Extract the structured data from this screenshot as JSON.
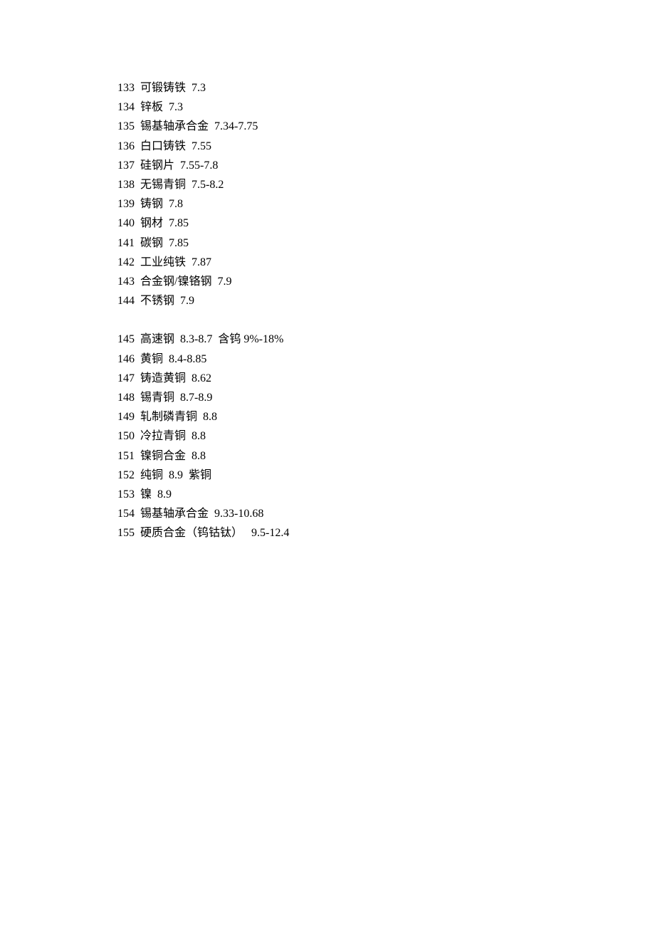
{
  "block1": [
    {
      "num": "133",
      "name": "可锻铸铁",
      "value": "7.3",
      "extra": ""
    },
    {
      "num": "134",
      "name": "锌板",
      "value": "7.3",
      "extra": ""
    },
    {
      "num": "135",
      "name": "锡基轴承合金",
      "value": "7.34-7.75",
      "extra": ""
    },
    {
      "num": "136",
      "name": "白口铸铁",
      "value": "7.55",
      "extra": ""
    },
    {
      "num": "137",
      "name": "硅钢片",
      "value": "7.55-7.8",
      "extra": ""
    },
    {
      "num": "138",
      "name": "无锡青铜",
      "value": "7.5-8.2",
      "extra": ""
    },
    {
      "num": "139",
      "name": "铸钢",
      "value": "7.8",
      "extra": ""
    },
    {
      "num": "140",
      "name": "钢材",
      "value": "7.85",
      "extra": ""
    },
    {
      "num": "141",
      "name": "碳钢",
      "value": "7.85",
      "extra": ""
    },
    {
      "num": "142",
      "name": "工业纯铁",
      "value": "7.87",
      "extra": ""
    },
    {
      "num": "143",
      "name": "合金钢/镍铬钢",
      "value": "7.9",
      "extra": ""
    },
    {
      "num": "144",
      "name": "不锈钢",
      "value": "7.9",
      "extra": ""
    }
  ],
  "block2": [
    {
      "num": "145",
      "name": "高速钢",
      "value": "8.3-8.7",
      "extra": "含钨 9%-18%"
    },
    {
      "num": "146",
      "name": "黄铜",
      "value": "8.4-8.85",
      "extra": ""
    },
    {
      "num": "147",
      "name": "铸造黄铜",
      "value": "8.62",
      "extra": ""
    },
    {
      "num": "148",
      "name": "锡青铜",
      "value": "8.7-8.9",
      "extra": ""
    },
    {
      "num": "149",
      "name": "轧制磷青铜",
      "value": "8.8",
      "extra": ""
    },
    {
      "num": "150",
      "name": "冷拉青铜",
      "value": "8.8",
      "extra": ""
    },
    {
      "num": "151",
      "name": "镍铜合金",
      "value": "8.8",
      "extra": ""
    },
    {
      "num": "152",
      "name": "纯铜",
      "value": "8.9",
      "extra": "紫铜"
    },
    {
      "num": "153",
      "name": "镍",
      "value": "8.9",
      "extra": ""
    },
    {
      "num": "154",
      "name": "锡基轴承合金",
      "value": "9.33-10.68",
      "extra": ""
    },
    {
      "num": "155",
      "name": "硬质合金（钨钴钛）",
      "value": " 9.5-12.4",
      "extra": ""
    }
  ]
}
